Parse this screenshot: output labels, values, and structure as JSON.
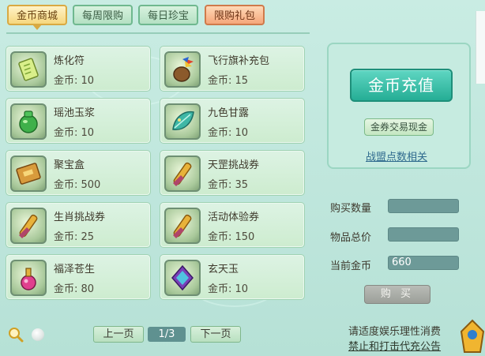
{
  "tabs": [
    {
      "label": "金币商城",
      "state": "active"
    },
    {
      "label": "每周限购",
      "state": "normal"
    },
    {
      "label": "每日珍宝",
      "state": "normal"
    },
    {
      "label": "限购礼包",
      "state": "limited"
    }
  ],
  "items": [
    {
      "name": "炼化符",
      "price": "金币: 10",
      "icon": "talisman-icon"
    },
    {
      "name": "飞行旗补充包",
      "price": "金币: 15",
      "icon": "flag-pouch-icon"
    },
    {
      "name": "瑶池玉浆",
      "price": "金币: 10",
      "icon": "jade-jar-icon"
    },
    {
      "name": "九色甘露",
      "price": "金币: 10",
      "icon": "dew-leaf-icon"
    },
    {
      "name": "聚宝盒",
      "price": "金币: 500",
      "icon": "treasure-box-icon"
    },
    {
      "name": "天罡挑战券",
      "price": "金币: 35",
      "icon": "scroll-icon"
    },
    {
      "name": "生肖挑战券",
      "price": "金币: 25",
      "icon": "scroll-icon"
    },
    {
      "name": "活动体验券",
      "price": "金币: 150",
      "icon": "scroll-icon"
    },
    {
      "name": "福泽苍生",
      "price": "金币: 80",
      "icon": "potion-icon"
    },
    {
      "name": "玄天玉",
      "price": "金币: 10",
      "icon": "jade-gem-icon"
    }
  ],
  "side": {
    "recharge": "金币充值",
    "trade": "金券交易现金",
    "alliance": "战盟点数相关",
    "qty_label": "购买数量",
    "total_label": "物品总价",
    "gold_label": "当前金币",
    "gold_value": "660",
    "buy": "购 买"
  },
  "pager": {
    "prev": "上一页",
    "page": "1/3",
    "next": "下一页"
  },
  "notice": {
    "line1": "请适度娱乐理性消费",
    "line2": "禁止和打击代充公告"
  }
}
